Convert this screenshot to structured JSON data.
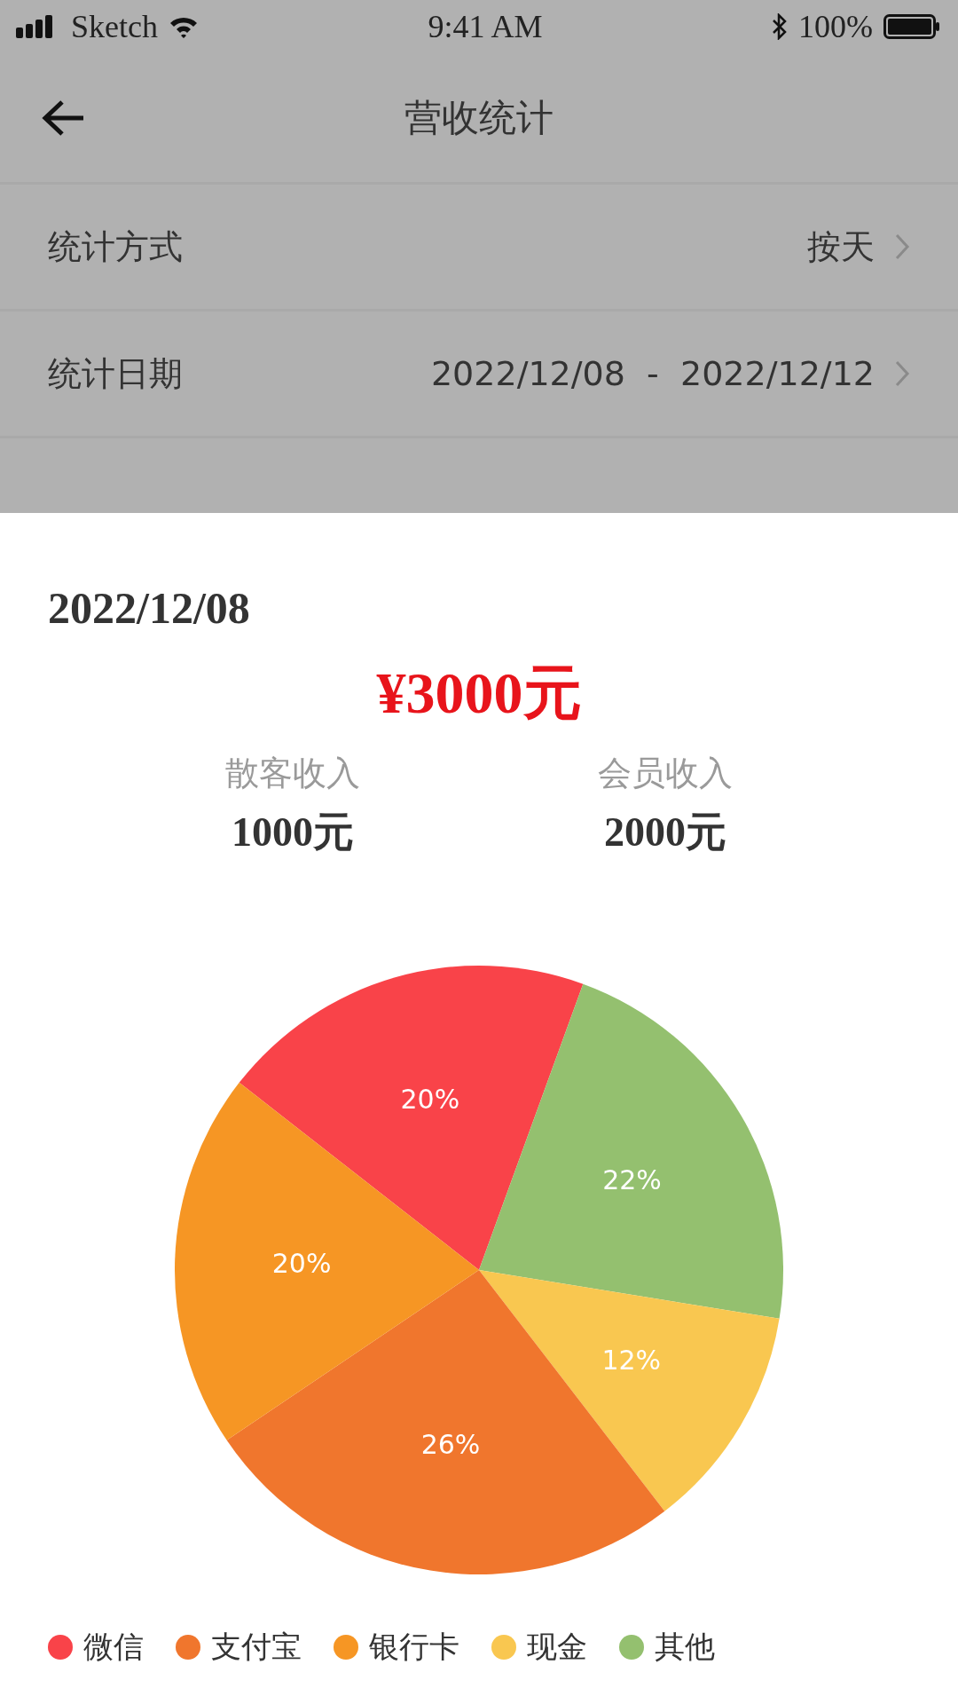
{
  "status_bar": {
    "carrier": "Sketch",
    "time": "9:41 AM",
    "battery": "100%"
  },
  "header": {
    "title": "营收统计"
  },
  "settings": [
    {
      "label": "统计方式",
      "value": "按天"
    },
    {
      "label": "统计日期",
      "value": "2022/12/08  -  2022/12/12"
    }
  ],
  "sheet": {
    "date": "2022/12/08",
    "total": "¥3000元",
    "breakdown": [
      {
        "label": "散客收入",
        "value": "1000元"
      },
      {
        "label": "会员收入",
        "value": "2000元"
      }
    ],
    "chart_data": {
      "type": "pie",
      "categories": [
        "微信",
        "支付宝",
        "银行卡",
        "现金",
        "其他"
      ],
      "values": [
        20,
        26,
        20,
        12,
        22
      ],
      "colors": [
        "#f94349",
        "#f0762d",
        "#f69624",
        "#f9c750",
        "#94c06f"
      ],
      "value_labels": [
        "20%",
        "26%",
        "20%",
        "12%",
        "22%"
      ]
    }
  }
}
